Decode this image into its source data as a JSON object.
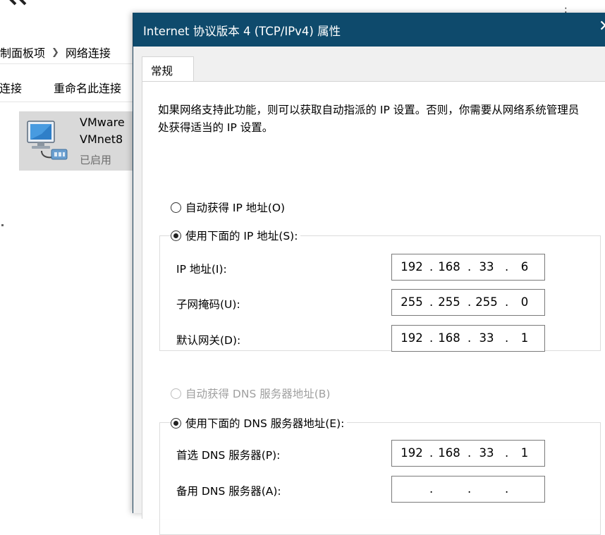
{
  "explorer": {
    "breadcrumb": [
      "制面板项",
      "网络连接"
    ],
    "toolbar": [
      "连接",
      "重命名此连接"
    ],
    "adapter": {
      "name_line1": "VMware",
      "name_line2": "VMnet8",
      "status": "已启用"
    }
  },
  "dialog": {
    "title": "Internet 协议版本 4 (TCP/IPv4) 属性",
    "tab": "常规",
    "description": "如果网络支持此功能，则可以获取自动指派的 IP 设置。否则，你需要从网络系统管理员处获得适当的 IP 设置。",
    "ip_auto_label": "自动获得 IP 地址(O)",
    "ip_manual_label": "使用下面的 IP 地址(S):",
    "ip_fields": [
      {
        "label": "IP 地址(I):",
        "octets": [
          "192",
          "168",
          "33",
          "6"
        ]
      },
      {
        "label": "子网掩码(U):",
        "octets": [
          "255",
          "255",
          "255",
          "0"
        ]
      },
      {
        "label": "默认网关(D):",
        "octets": [
          "192",
          "168",
          "33",
          "1"
        ]
      }
    ],
    "dns_auto_label": "自动获得 DNS 服务器地址(B)",
    "dns_manual_label": "使用下面的 DNS 服务器地址(E):",
    "dns_fields": [
      {
        "label": "首选 DNS 服务器(P):",
        "octets": [
          "192",
          "168",
          "33",
          "1"
        ]
      },
      {
        "label": "备用 DNS 服务器(A):",
        "octets": [
          "",
          "",
          "",
          ""
        ]
      }
    ],
    "icons": {
      "close": "close-icon",
      "adapter": "network-adapter-icon"
    }
  }
}
